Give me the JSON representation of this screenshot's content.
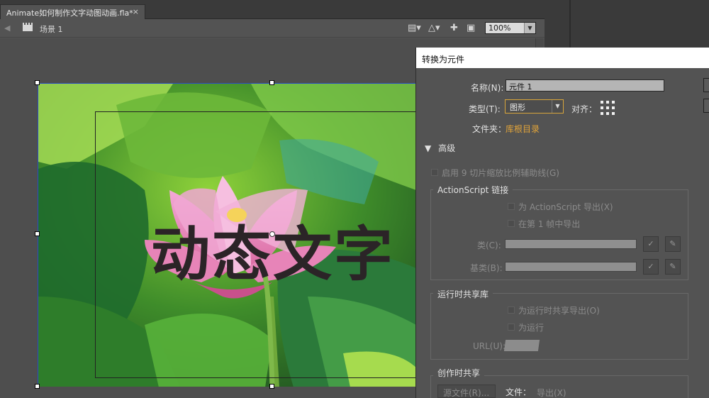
{
  "document_tab": {
    "title": "Animate如何制作文字动图动画.fla*",
    "close": "×"
  },
  "edit_bar": {
    "scene_label": "场景 1",
    "zoom": "100%",
    "icons": [
      "back-arrow-icon",
      "scene-clapper-icon",
      "edit-symbols-icon",
      "center-stage-icon",
      "clip-stage-icon",
      "zoom-dropdown-icon"
    ]
  },
  "stage": {
    "text_overlay": "动态文字",
    "image": "pink-lotus-flower-with-green-leaves"
  },
  "dialog": {
    "title": "转换为元件",
    "name_label": "名称(N):",
    "name_value": "元件 1",
    "type_label": "类型(T):",
    "type_value": "图形",
    "align_label": "对齐：",
    "folder_label": "文件夹：",
    "folder_value": "库根目录",
    "advanced_label": "高级",
    "enable_9slice": "启用 9 切片缩放比例辅助线(G)",
    "actionscript_group": "ActionScript 链接",
    "export_for_as": "为 ActionScript 导出(X)",
    "export_frame1": "在第 1 帧中导出",
    "class_label": "类(C):",
    "base_class_label": "基类(B):",
    "runtime_group": "运行时共享库",
    "export_runtime": "为运行时共享导出(O)",
    "import_runtime": "为运行",
    "url_label": "URL(U):",
    "author_group": "创作时共享",
    "source_file_btn": "源文件(R)...",
    "file_label": "文件：",
    "export_label": "导出(X)"
  },
  "colors": {
    "accent_orange": "#e1a43a",
    "panel_bg": "#535353",
    "selection_blue": "#2c4cc2"
  }
}
